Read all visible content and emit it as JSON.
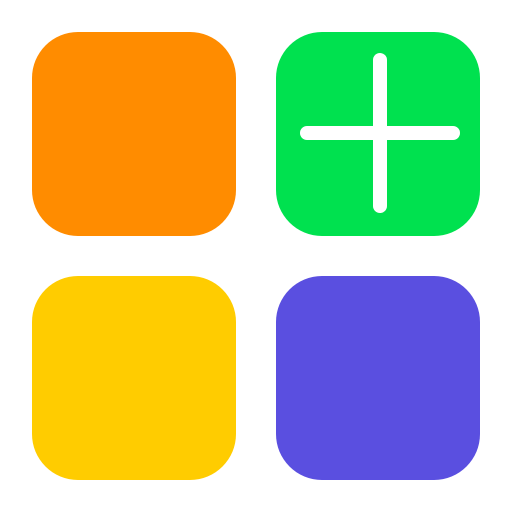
{
  "tiles": [
    {
      "id": "tile-tl",
      "name": "orange-tile",
      "color": "#FF8C00",
      "icon": null
    },
    {
      "id": "tile-tr",
      "name": "add-tile",
      "color": "#00E14F",
      "icon": "plus-icon"
    },
    {
      "id": "tile-bl",
      "name": "yellow-tile",
      "color": "#FFCC00",
      "icon": null
    },
    {
      "id": "tile-br",
      "name": "purple-tile",
      "color": "#5A4FE0",
      "icon": null
    }
  ]
}
